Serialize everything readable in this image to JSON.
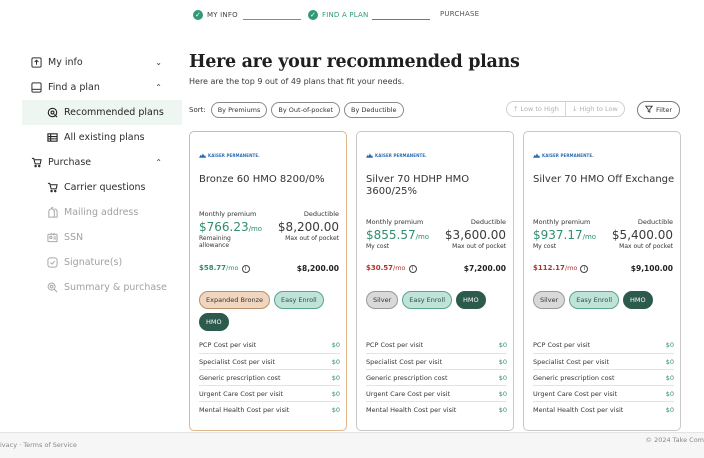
{
  "stepper": {
    "steps": [
      {
        "label": "MY INFO",
        "state": "done"
      },
      {
        "label": "FIND A PLAN",
        "state": "current"
      },
      {
        "label": "PURCHASE",
        "state": "upcoming"
      }
    ]
  },
  "sidebar": {
    "my_info": "My info",
    "find_a_plan": "Find a plan",
    "recommended_plans": "Recommended plans",
    "all_existing_plans": "All existing plans",
    "purchase": "Purchase",
    "carrier_questions": "Carrier questions",
    "mailing_address": "Mailing address",
    "ssn": "SSN",
    "signatures": "Signature(s)",
    "summary_purchase": "Summary & purchase"
  },
  "main": {
    "title": "Here are your recommended plans",
    "subtitle": "Here are the top 9 out of 49 plans that fit your needs.",
    "sort_label": "Sort:",
    "sort_options": [
      "By Premiums",
      "By Out-of-pocket",
      "By Deductible"
    ],
    "order_low_high": "↑ Low to High",
    "order_high_low": "↓ High to Low",
    "filter": "Filter"
  },
  "cards": [
    {
      "carrier": "KAISER PERMANENTE.",
      "name": "Bronze 60 HMO 8200/0%",
      "premium_label": "Monthly premium",
      "premium": "$766.23",
      "premium_unit": "/mo",
      "deductible_label": "Deductible",
      "deductible": "$8,200.00",
      "left_note": "Remaining allowance",
      "right_note": "Max out of pocket",
      "net": "$58.77",
      "net_unit": "/mo",
      "oop": "$8,200.00",
      "tags": [
        "Expanded Bronze",
        "Easy Enroll",
        "HMO"
      ],
      "costs": [
        {
          "label": "PCP Cost per visit",
          "value": "$0"
        },
        {
          "label": "Specialist Cost per visit",
          "value": "$0"
        },
        {
          "label": "Generic prescription cost",
          "value": "$0"
        },
        {
          "label": "Urgent Care Cost per visit",
          "value": "$0"
        },
        {
          "label": "Mental Health Cost per visit",
          "value": "$0"
        }
      ]
    },
    {
      "carrier": "KAISER PERMANENTE.",
      "name": "Silver 70 HDHP HMO 3600/25%",
      "premium_label": "Monthly premium",
      "premium": "$855.57",
      "premium_unit": "/mo",
      "deductible_label": "Deductible",
      "deductible": "$3,600.00",
      "left_note": "My cost",
      "right_note": "Max out of pocket",
      "net": "$30.57",
      "net_unit": "/mo",
      "oop": "$7,200.00",
      "tags": [
        "Silver",
        "Easy Enroll",
        "HMO"
      ],
      "costs": [
        {
          "label": "PCP Cost per visit",
          "value": "$0"
        },
        {
          "label": "Specialist Cost per visit",
          "value": "$0"
        },
        {
          "label": "Generic prescription cost",
          "value": "$0"
        },
        {
          "label": "Urgent Care Cost per visit",
          "value": "$0"
        },
        {
          "label": "Mental Health Cost per visit",
          "value": "$0"
        }
      ]
    },
    {
      "carrier": "KAISER PERMANENTE.",
      "name": "Silver 70 HMO Off Exchange",
      "premium_label": "Monthly premium",
      "premium": "$937.17",
      "premium_unit": "/mo",
      "deductible_label": "Deductible",
      "deductible": "$5,400.00",
      "left_note": "My cost",
      "right_note": "Max out of pocket",
      "net": "$112.17",
      "net_unit": "/mo",
      "oop": "$9,100.00",
      "tags": [
        "Silver",
        "Easy Enroll",
        "HMO"
      ],
      "costs": [
        {
          "label": "PCP Cost per visit",
          "value": "$0"
        },
        {
          "label": "Specialist Cost per visit",
          "value": "$0"
        },
        {
          "label": "Generic prescription cost",
          "value": "$0"
        },
        {
          "label": "Urgent Care Cost per visit",
          "value": "$0"
        },
        {
          "label": "Mental Health Cost per visit",
          "value": "$0"
        }
      ]
    }
  ],
  "footer": {
    "links": "ivacy · Terms of Service",
    "copyright": "© 2024 Take Com"
  },
  "colors": {
    "accent_green": "#2f9a73",
    "negative_red": "#b3322a",
    "hmo_tag": "#2c5a4d"
  }
}
